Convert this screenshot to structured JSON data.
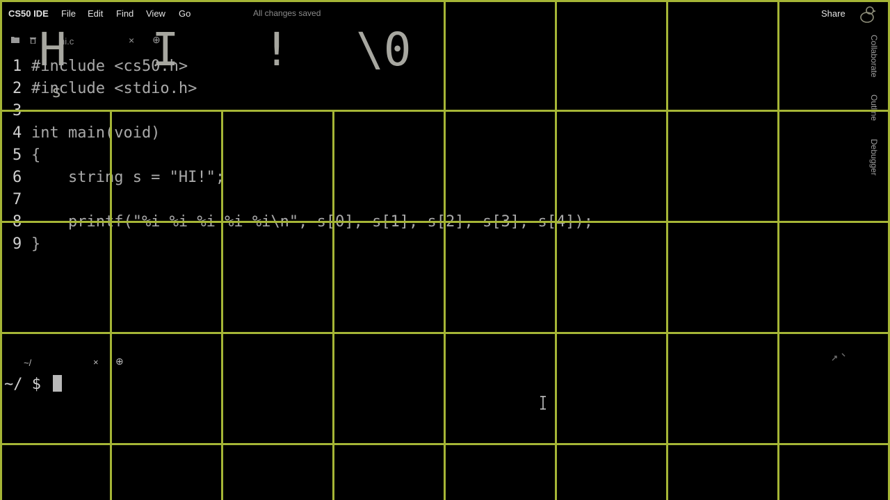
{
  "app": {
    "title": "CS50 IDE",
    "menu": [
      "File",
      "Edit",
      "Find",
      "View",
      "Go"
    ],
    "status": "All changes saved",
    "share_label": "Share"
  },
  "file_tab": {
    "name": "hi.c",
    "close_glyph": "×",
    "add_glyph": "⊕"
  },
  "memory_overlay": {
    "chars": [
      "H",
      "I",
      "!",
      "\\0"
    ],
    "variable_label": "s"
  },
  "editor": {
    "lines": [
      {
        "num": "1",
        "code": "#include <cs50.h>"
      },
      {
        "num": "2",
        "code": "#include <stdio.h>"
      },
      {
        "num": "3",
        "code": ""
      },
      {
        "num": "4",
        "code": "int main(void)"
      },
      {
        "num": "5",
        "code": "{"
      },
      {
        "num": "6",
        "code": "    string s = \"HI!\";"
      },
      {
        "num": "7",
        "code": ""
      },
      {
        "num": "8",
        "code": "    printf(\"%i %i %i %i %i\\n\", s[0], s[1], s[2], s[3], s[4]);"
      },
      {
        "num": "9",
        "code": "}"
      }
    ]
  },
  "sidebar": {
    "tabs": [
      "Collaborate",
      "Outline",
      "Debugger"
    ]
  },
  "terminal": {
    "tab_title": "~/",
    "close_glyph": "×",
    "add_glyph": "⊕",
    "prompt": "~/ $ "
  },
  "colors": {
    "background": "#000000",
    "grid": "#a5b536",
    "overlay_text": "#a7a7a0"
  }
}
